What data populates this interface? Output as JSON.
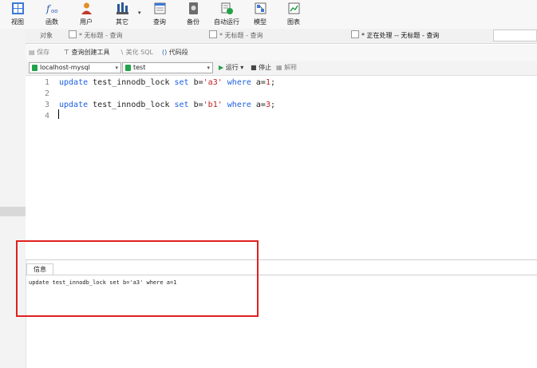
{
  "toolbar": {
    "items": [
      {
        "label": "视图",
        "icon": "grid-icon"
      },
      {
        "label": "函数",
        "icon": "function-icon"
      },
      {
        "label": "用户",
        "icon": "user-icon"
      },
      {
        "label": "其它",
        "icon": "tools-icon"
      },
      {
        "label": "查询",
        "icon": "query-icon"
      },
      {
        "label": "备份",
        "icon": "backup-icon"
      },
      {
        "label": "自动运行",
        "icon": "schedule-icon"
      },
      {
        "label": "模型",
        "icon": "model-icon"
      },
      {
        "label": "图表",
        "icon": "chart-icon"
      }
    ]
  },
  "tabs": [
    {
      "label": "对象",
      "active": false
    },
    {
      "label": "* 无标题 - 查询",
      "active": false
    },
    {
      "label": "* 无标题 - 查询",
      "active": false
    },
    {
      "label": "* 正在处理 -- 无标题 - 查询",
      "active": true
    }
  ],
  "query_toolbar": {
    "save": "保存",
    "builder": "查询创建工具",
    "beautify": "美化 SQL",
    "snippet": "代码段"
  },
  "connection": {
    "server": "localhost-mysql",
    "database": "test",
    "run": "运行",
    "stop": "停止",
    "explain": "解释"
  },
  "editor": {
    "line_numbers": [
      "1",
      "2",
      "3",
      "4"
    ],
    "lines": [
      [
        {
          "t": "kw",
          "v": "update "
        },
        {
          "t": "plain",
          "v": "test_innodb_lock "
        },
        {
          "t": "kw",
          "v": "set "
        },
        {
          "t": "plain",
          "v": "b="
        },
        {
          "t": "str",
          "v": "'a3'"
        },
        {
          "t": "plain",
          "v": " "
        },
        {
          "t": "kw",
          "v": "where "
        },
        {
          "t": "plain",
          "v": "a="
        },
        {
          "t": "num",
          "v": "1"
        },
        {
          "t": "plain",
          "v": ";"
        }
      ],
      [],
      [
        {
          "t": "kw",
          "v": "update "
        },
        {
          "t": "plain",
          "v": "test_innodb_lock "
        },
        {
          "t": "kw",
          "v": "set "
        },
        {
          "t": "plain",
          "v": "b="
        },
        {
          "t": "str",
          "v": "'b1'"
        },
        {
          "t": "plain",
          "v": " "
        },
        {
          "t": "kw",
          "v": "where "
        },
        {
          "t": "plain",
          "v": "a="
        },
        {
          "t": "num",
          "v": "3"
        },
        {
          "t": "plain",
          "v": ";"
        }
      ],
      []
    ]
  },
  "info": {
    "tab_label": "信息",
    "message": "update test_innodb_lock set b='a3' where a=1"
  },
  "colors": {
    "keyword": "#1b5fe0",
    "string": "#c02020",
    "highlight_box": "#e02020"
  }
}
